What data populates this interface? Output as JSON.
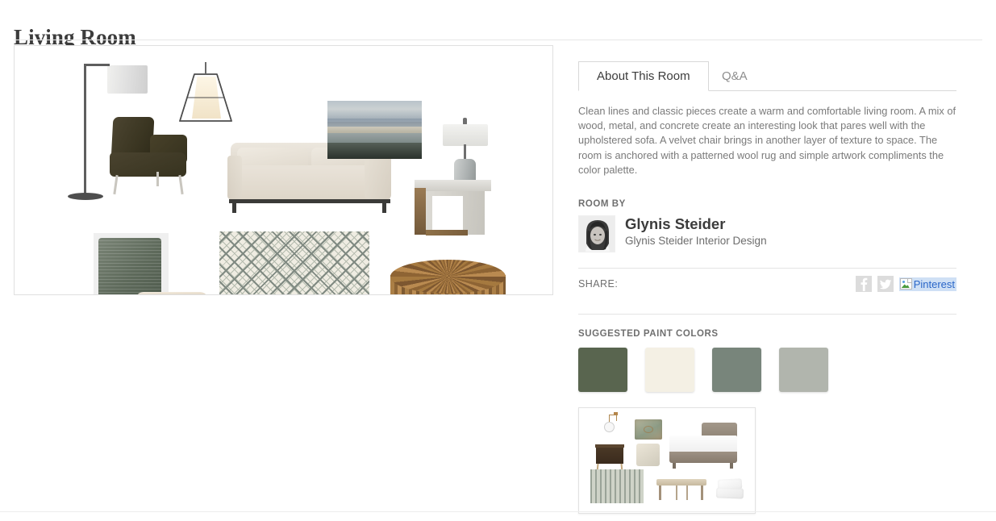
{
  "page": {
    "title": "Living Room"
  },
  "board": {
    "name": "living-room-mood-board",
    "items": [
      {
        "name": "arc-floor-lamp",
        "label": "Arc floor lamp with drum shade"
      },
      {
        "name": "lantern-pendant-light",
        "label": "Black frame lantern pendant light"
      },
      {
        "name": "velvet-slipper-chair",
        "label": "Dark olive velvet armless chair"
      },
      {
        "name": "upholstered-sofa",
        "label": "Cream upholstered sofa with metal base"
      },
      {
        "name": "abstract-seascape-artwork",
        "label": "Abstract blue and cream seascape painting"
      },
      {
        "name": "ceramic-table-lamp",
        "label": "Gray ceramic table lamp"
      },
      {
        "name": "concrete-wood-side-table",
        "label": "Concrete and wood cube side table"
      },
      {
        "name": "green-square-pillow",
        "label": "Green textured square pillow"
      },
      {
        "name": "cream-lumbar-pillow",
        "label": "Cream pleated lumbar pillow"
      },
      {
        "name": "patterned-wool-rug",
        "label": "Patterned diamond wool rug"
      },
      {
        "name": "round-wood-coffee-table",
        "label": "Round reclaimed wood coffee table"
      }
    ]
  },
  "tabs": [
    {
      "label": "About This Room",
      "active": true
    },
    {
      "label": "Q&A",
      "active": false
    }
  ],
  "about": {
    "description": "Clean lines and classic pieces create a warm and comfortable living room. A mix of wood, metal, and concrete create an interesting look that pares well with the upholstered sofa. A velvet chair brings in another layer of texture to space. The room is anchored with a patterned wool rug and simple artwork compliments the color palette."
  },
  "room_by": {
    "label": "ROOM BY",
    "designer_name": "Glynis Steider",
    "designer_company": "Glynis Steider Interior Design",
    "avatar_alt": "Glynis Steider"
  },
  "share": {
    "label": "SHARE:",
    "items": [
      {
        "name": "facebook",
        "label": "f"
      },
      {
        "name": "twitter",
        "label": ""
      },
      {
        "name": "pinterest",
        "label": "Pinterest",
        "broken_image": true
      }
    ]
  },
  "paint": {
    "label": "SUGGESTED PAINT COLORS",
    "swatches": [
      {
        "name": "dark-olive-green",
        "hex": "#59654f"
      },
      {
        "name": "cream-white",
        "hex": "#f4f0e4"
      },
      {
        "name": "sage-green",
        "hex": "#78857b"
      },
      {
        "name": "light-gray-green",
        "hex": "#b1b5ad"
      }
    ]
  },
  "related": {
    "name": "related-bedroom-board",
    "label": "Bedroom mood board thumbnail",
    "items": [
      {
        "name": "pendant-sconce"
      },
      {
        "name": "dark-wood-nightstand"
      },
      {
        "name": "patterned-lumbar-pillow"
      },
      {
        "name": "neutral-square-pillow"
      },
      {
        "name": "upholstered-bed"
      },
      {
        "name": "striped-area-rug"
      },
      {
        "name": "wood-bench"
      },
      {
        "name": "white-bedding-stack"
      }
    ]
  }
}
